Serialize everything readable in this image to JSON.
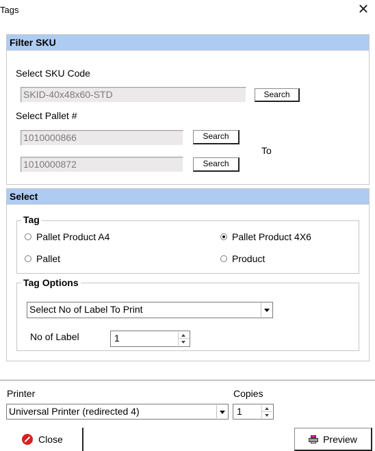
{
  "window": {
    "title": "Tags"
  },
  "filter_sku": {
    "header": "Filter SKU",
    "sku_label": "Select SKU Code",
    "sku_value": "SKID-40x48x60-STD",
    "sku_search": "Search",
    "pallet_label": "Select Pallet #",
    "pallet_from": "1010000866",
    "pallet_from_search": "Search",
    "to_label": "To",
    "pallet_to": "1010000872",
    "pallet_to_search": "Search"
  },
  "select": {
    "header": "Select",
    "tag_legend": "Tag",
    "tag_options": [
      {
        "label": "Pallet Product A4",
        "checked": false
      },
      {
        "label": "Pallet Product 4X6",
        "checked": true
      },
      {
        "label": "Pallet",
        "checked": false
      },
      {
        "label": "Product",
        "checked": false
      }
    ],
    "options_legend": "Tag Options",
    "label_select": "Select No of Label To Print",
    "no_of_label_label": "No of Label",
    "no_of_label_value": "1"
  },
  "footer": {
    "printer_label": "Printer",
    "printer_value": "Universal Printer  (redirected 4)",
    "copies_label": "Copies",
    "copies_value": "1",
    "close_label": "Close",
    "preview_label": "Preview"
  }
}
